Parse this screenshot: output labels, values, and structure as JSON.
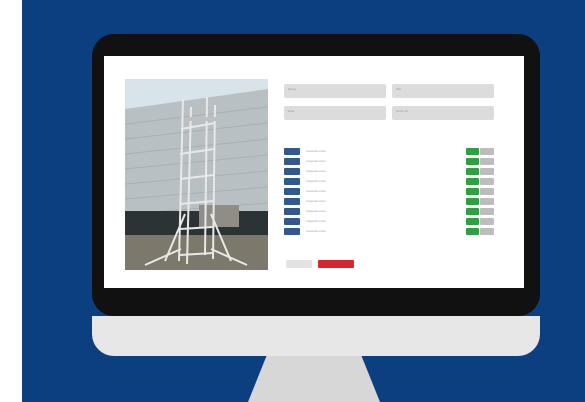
{
  "colors": {
    "background": "#0b3f7f",
    "check_button": "#33588f",
    "yes_button": "#2ea042",
    "no_button": "#bdbdbd",
    "submit_button": "#d7262f"
  },
  "form": {
    "fields": [
      {
        "placeholder": "Name"
      },
      {
        "placeholder": "Site"
      },
      {
        "placeholder": "Date"
      },
      {
        "placeholder": "Tower ID"
      }
    ],
    "checklist": [
      {
        "text": "Inspection item",
        "yes": "",
        "no": ""
      },
      {
        "text": "Inspection item",
        "yes": "",
        "no": ""
      },
      {
        "text": "Inspection item",
        "yes": "",
        "no": ""
      },
      {
        "text": "Inspection item",
        "yes": "",
        "no": ""
      },
      {
        "text": "Inspection item",
        "yes": "",
        "no": ""
      },
      {
        "text": "Inspection item",
        "yes": "",
        "no": ""
      },
      {
        "text": "Inspection item",
        "yes": "",
        "no": ""
      },
      {
        "text": "Inspection item",
        "yes": "",
        "no": ""
      },
      {
        "text": "Inspection item",
        "yes": "",
        "no": ""
      }
    ],
    "cancel_label": "",
    "submit_label": ""
  },
  "photo": {
    "icon": "scaffold-tower-photo"
  }
}
